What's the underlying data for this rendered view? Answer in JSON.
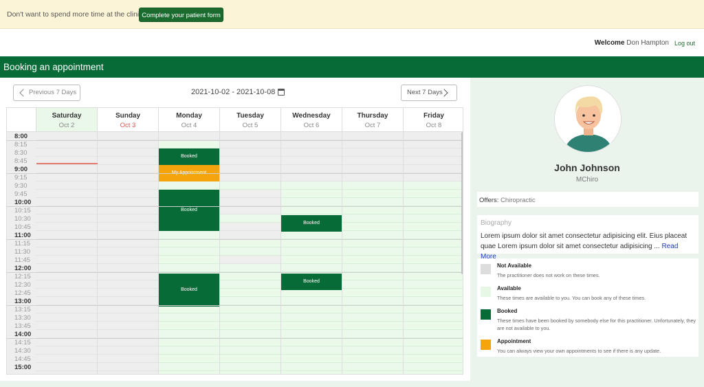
{
  "banner": {
    "text": "Don't want to spend more time at the clinic?",
    "button": "Complete your patient form"
  },
  "user": {
    "welcome": "Welcome",
    "name": "Don Hampton",
    "logout": "Log out"
  },
  "page_title": "Booking an appointment",
  "nav": {
    "prev": "Previous 7 Days",
    "next": "Next 7 Days",
    "range": "2021-10-02 - 2021-10-08"
  },
  "days": [
    {
      "name": "Saturday",
      "date": "Oct 2"
    },
    {
      "name": "Sunday",
      "date": "Oct 3"
    },
    {
      "name": "Monday",
      "date": "Oct 4"
    },
    {
      "name": "Tuesday",
      "date": "Oct 5"
    },
    {
      "name": "Wednesday",
      "date": "Oct 6"
    },
    {
      "name": "Thursday",
      "date": "Oct 7"
    },
    {
      "name": "Friday",
      "date": "Oct 8"
    }
  ],
  "times": [
    "8:00",
    "8:15",
    "8:30",
    "8:45",
    "9:00",
    "9:15",
    "9:30",
    "9:45",
    "10:00",
    "10:15",
    "10:30",
    "10:45",
    "11:00",
    "11:15",
    "11:30",
    "11:45",
    "12:00",
    "12:15",
    "12:30",
    "12:45",
    "13:00",
    "13:15",
    "13:30",
    "13:45",
    "14:00",
    "14:15",
    "14:30",
    "14:45",
    "15:00"
  ],
  "events": {
    "booked": "Booked",
    "mine": "My Appointment"
  },
  "practitioner": {
    "name": "John Johnson",
    "credential": "MChiro",
    "offers_label": "Offers:",
    "offers": "Chiropractic"
  },
  "bio": {
    "title": "Biography",
    "text": "Lorem ipsum dolor sit amet consectetur adipisicing elit. Eius placeat quae Lorem ipsum dolor sit amet consectetur adipisicing ...",
    "more": "Read More"
  },
  "legend": [
    {
      "title": "Not Available",
      "desc": "The practitioner does not work on these times.",
      "color": "#dddddd"
    },
    {
      "title": "Available",
      "desc": "These times are available to you. You can book any of these times.",
      "color": "#e6f8e5"
    },
    {
      "title": "Booked",
      "desc": "These times have been booked by somebody else for this practitioner. Unfortunately, they are not available to you.",
      "color": "#066b36"
    },
    {
      "title": "Appointment",
      "desc": "You can always view your own appointments to see if there is any update.",
      "color": "#f5a40b"
    }
  ],
  "colors": {
    "brand": "#066b36",
    "appointment": "#f5a40b",
    "now_line": "#e27b6f"
  }
}
